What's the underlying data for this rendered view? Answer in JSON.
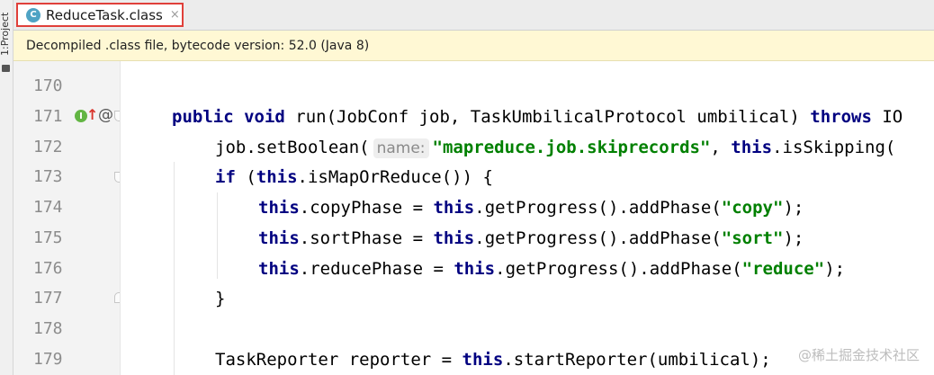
{
  "sidebar": {
    "project_label": "1:Project"
  },
  "tab": {
    "icon_letter": "C",
    "title": "ReduceTask.class",
    "close_glyph": "×"
  },
  "banner": {
    "text": "Decompiled .class file, bytecode version: 52.0 (Java 8)"
  },
  "editor": {
    "line_numbers": [
      "170",
      "171",
      "172",
      "173",
      "174",
      "175",
      "176",
      "177",
      "178",
      "179"
    ],
    "gutter_icons": {
      "implements_letter": "I",
      "arrow": "↑",
      "annotation": "@"
    },
    "lines": {
      "l171": {
        "kw1": "public",
        "kw2": "void",
        "text": " run(JobConf job, TaskUmbilicalProtocol umbilical) ",
        "kw3": "throws",
        "tail": " IO"
      },
      "l172": {
        "pre": "job.setBoolean(",
        "hint": "name:",
        "str": "\"mapreduce.job.skiprecords\"",
        "mid": ", ",
        "kw": "this",
        "tail": ".isSkipping("
      },
      "l173": {
        "kw1": "if",
        "mid": " (",
        "kw2": "this",
        "tail": ".isMapOrReduce()) {"
      },
      "l174": {
        "kw1": "this",
        "mid": ".copyPhase = ",
        "kw2": "this",
        "call": ".getProgress().addPhase(",
        "str": "\"copy\"",
        "tail": ");"
      },
      "l175": {
        "kw1": "this",
        "mid": ".sortPhase = ",
        "kw2": "this",
        "call": ".getProgress().addPhase(",
        "str": "\"sort\"",
        "tail": ");"
      },
      "l176": {
        "kw1": "this",
        "mid": ".reducePhase = ",
        "kw2": "this",
        "call": ".getProgress().addPhase(",
        "str": "\"reduce\"",
        "tail": ");"
      },
      "l177": {
        "text": "}"
      },
      "l179": {
        "pre": "TaskReporter reporter = ",
        "kw": "this",
        "tail": ".startReporter(umbilical);"
      }
    }
  },
  "watermark": "@稀土掘金技术社区",
  "colors": {
    "keyword": "#000080",
    "string": "#008000",
    "tab_highlight": "#e0403a",
    "banner_bg": "#fff8d4"
  }
}
